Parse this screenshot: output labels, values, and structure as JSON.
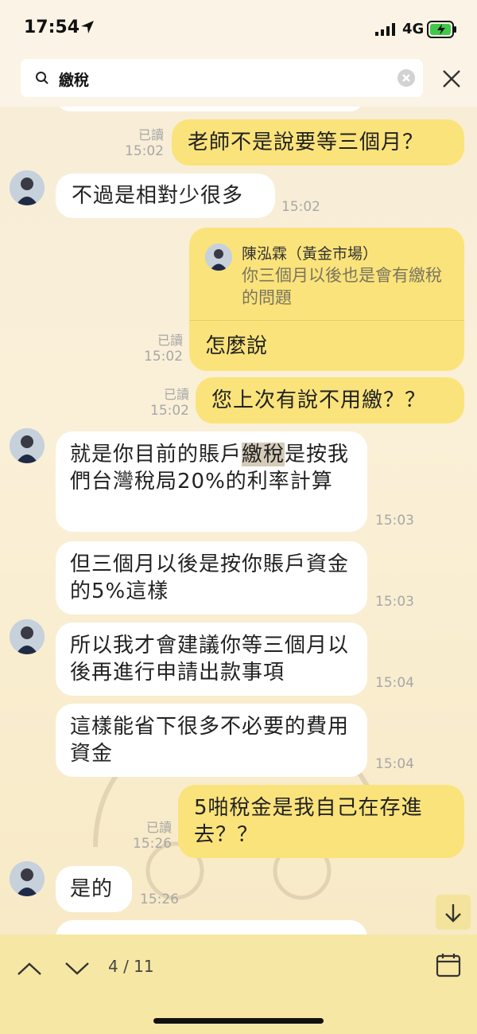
{
  "status": {
    "time": "17:54",
    "network": "4G"
  },
  "search": {
    "query": "繳稅"
  },
  "messages": {
    "m1": {
      "text": "老師不是說要等三個月？",
      "read": "已讀",
      "time": "15:02"
    },
    "m2": {
      "text": "不過是相對少很多",
      "time": "15:02"
    },
    "m3": {
      "quote_name": "陳泓霖（黃金市場）",
      "quote_text": "你三個月以後也是會有繳稅的問題",
      "text": "怎麼說",
      "read": "已讀",
      "time": "15:02"
    },
    "m4": {
      "text": "您上次有說不用繳？？",
      "read": "已讀",
      "time": "15:02"
    },
    "m5": {
      "text_before": "就是你目前的賬戶",
      "text_hl": "繳稅",
      "text_after": "是按我們台灣稅局20%的利率計算",
      "time": "15:03"
    },
    "m6": {
      "text": "但三個月以後是按你賬戶資金的5%這樣",
      "time": "15:03"
    },
    "m7": {
      "text": "所以我才會建議你等三個月以後再進行申請出款事項",
      "time": "15:04"
    },
    "m8": {
      "text": "這樣能省下很多不必要的費用資金",
      "time": "15:04"
    },
    "m9": {
      "text": "5啪稅金是我自己在存進去？？",
      "read": "已讀",
      "time": "15:26"
    },
    "m10": {
      "text": "是的",
      "time": "15:26"
    }
  },
  "navigation": {
    "counter": "4 / 11"
  },
  "icons": [
    "location-arrow-icon",
    "signal-icon",
    "battery-icon",
    "search-icon",
    "clear-icon",
    "close-icon",
    "chevron-up-icon",
    "chevron-down-icon",
    "calendar-icon",
    "arrow-down-icon"
  ]
}
